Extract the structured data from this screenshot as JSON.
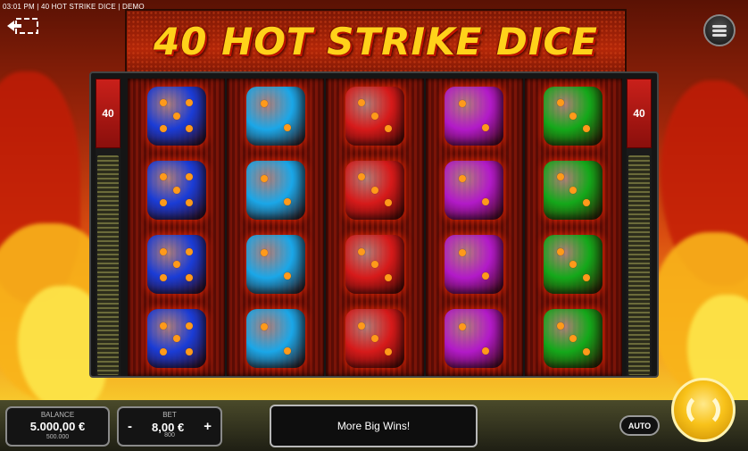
{
  "status_bar": {
    "text": "03:01 PM | 40 HOT STRIKE DICE | DEMO"
  },
  "header": {
    "title": "40 HOT STRIKE DICE"
  },
  "lines": {
    "left": "40",
    "right": "40"
  },
  "reels": [
    {
      "color": "blue",
      "faces": [
        5,
        5,
        5,
        5
      ]
    },
    {
      "color": "cyan",
      "faces": [
        2,
        2,
        2,
        2
      ]
    },
    {
      "color": "red",
      "faces": [
        3,
        3,
        3,
        3
      ]
    },
    {
      "color": "magenta",
      "faces": [
        2,
        2,
        2,
        2
      ]
    },
    {
      "color": "green",
      "faces": [
        3,
        3,
        3,
        3
      ]
    }
  ],
  "balance": {
    "label": "BALANCE",
    "value": "5.000,00 €",
    "sub": "500.000"
  },
  "bet": {
    "label": "BET",
    "value": "8,00 €",
    "sub": "800",
    "minus": "-",
    "plus": "+"
  },
  "message": "More Big Wins!",
  "auto_label": "AUTO",
  "icons": {
    "back": "back-arrow-icon",
    "menu": "menu-icon",
    "spin": "spin-icon"
  },
  "colors": {
    "accent": "#ffd21a",
    "frame": "#151515",
    "blue": "#1a3cd6",
    "cyan": "#1aa7e8",
    "red": "#d61a1a",
    "magenta": "#b21ac8",
    "green": "#14a81a"
  }
}
